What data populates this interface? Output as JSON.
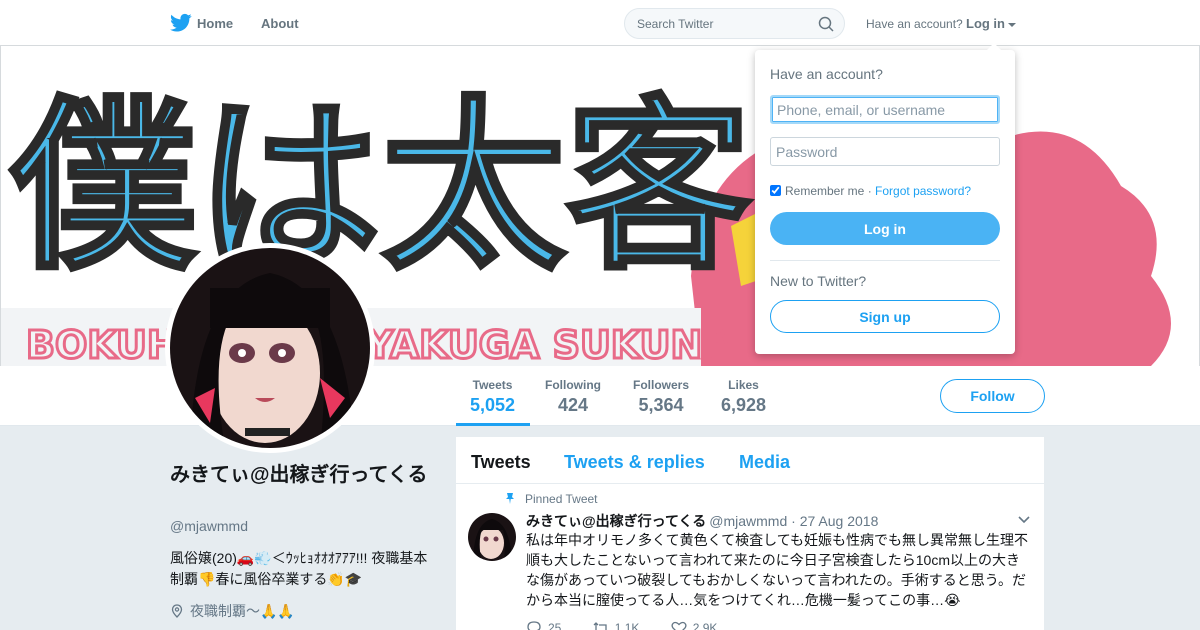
{
  "nav": {
    "home_label": "Home",
    "about_label": "About",
    "search_placeholder": "Search Twitter",
    "have_account_label": "Have an account?",
    "login_label": "Log in"
  },
  "banner": {
    "art_text": "僕は太客が",
    "sub_text": "BOKUHA FUTOKYAKUGA SUKUNAI",
    "colors": {
      "blue": "#4ab8e8",
      "pink": "#e86a88",
      "gray": "#cfd4d8"
    }
  },
  "stats": [
    {
      "label": "Tweets",
      "value": "5,052",
      "active": true
    },
    {
      "label": "Following",
      "value": "424",
      "active": false
    },
    {
      "label": "Followers",
      "value": "5,364",
      "active": false
    },
    {
      "label": "Likes",
      "value": "6,928",
      "active": false
    }
  ],
  "follow_label": "Follow",
  "profile": {
    "name": "みきてぃ@出稼ぎ行ってくる",
    "handle": "@mjawmmd",
    "bio": "風俗嬢(20)🚗💨＜ｳｯﾋｮｵｵｵｱｱｱ!!! 夜職基本制覇👎春に風俗卒業する👏🎓",
    "location": "夜職制覇〜🙏🙏"
  },
  "timeline": {
    "tabs": [
      "Tweets",
      "Tweets & replies",
      "Media"
    ],
    "pinned_label": "Pinned Tweet",
    "tweet": {
      "name": "みきてぃ@出稼ぎ行ってくる",
      "handle": "@mjawmmd",
      "date": "27 Aug 2018",
      "text": "私は年中オリモノ多くて黄色くて検査しても妊娠も性病でも無し異常無し生理不順も大したことないって言われて来たのに今日子宮検査したら10cm以上の大きな傷があっていつ破裂してもおかしくないって言われたの。手術すると思う。だから本当に膣使ってる人…気をつけてくれ…危機一髪ってこの事…😭",
      "replies": "25",
      "retweets": "1.1K",
      "likes": "2.9K"
    }
  },
  "login_dropdown": {
    "title": "Have an account?",
    "username_placeholder": "Phone, email, or username",
    "password_placeholder": "Password",
    "remember_label": "Remember me",
    "separator": "·",
    "forgot_label": "Forgot password?",
    "login_button": "Log in",
    "new_label": "New to Twitter?",
    "signup_button": "Sign up"
  },
  "colors": {
    "accent": "#1da1f2",
    "text": "#14171a",
    "muted": "#657786",
    "page_bg": "#e6ecf0"
  }
}
